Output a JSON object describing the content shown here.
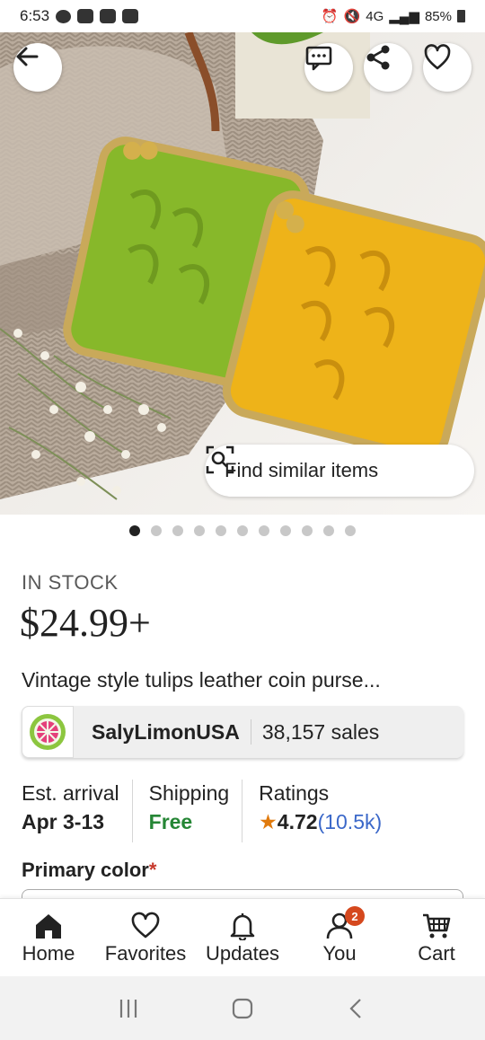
{
  "status_bar": {
    "time": "6:53",
    "network": "4G",
    "battery": "85%"
  },
  "hero": {
    "find_similar_label": "Find similar items",
    "image_count": 11,
    "active_index": 0
  },
  "product": {
    "stock_status": "IN STOCK",
    "price": "$24.99+",
    "title": "Vintage style tulips leather coin purse..."
  },
  "shop": {
    "name": "SalyLimonUSA",
    "sales": "38,157 sales"
  },
  "info": {
    "arrival_label": "Est. arrival",
    "arrival_value": "Apr 3-13",
    "shipping_label": "Shipping",
    "shipping_value": "Free",
    "ratings_label": "Ratings",
    "rating_value": "4.72",
    "rating_count": "(10.5k)"
  },
  "primary_color_label": "Primary color",
  "primary_color_required": "*",
  "bottom_nav": {
    "items": [
      {
        "label": "Home",
        "icon": "home-icon",
        "active": true
      },
      {
        "label": "Favorites",
        "icon": "heart-icon"
      },
      {
        "label": "Updates",
        "icon": "bell-icon"
      },
      {
        "label": "You",
        "icon": "person-icon",
        "badge": "2"
      },
      {
        "label": "Cart",
        "icon": "cart-icon"
      }
    ]
  },
  "colors": {
    "accent_green": "#258635",
    "link_blue": "#3b68c9",
    "badge_orange": "#d5481e",
    "star_orange": "#e07a0d"
  }
}
